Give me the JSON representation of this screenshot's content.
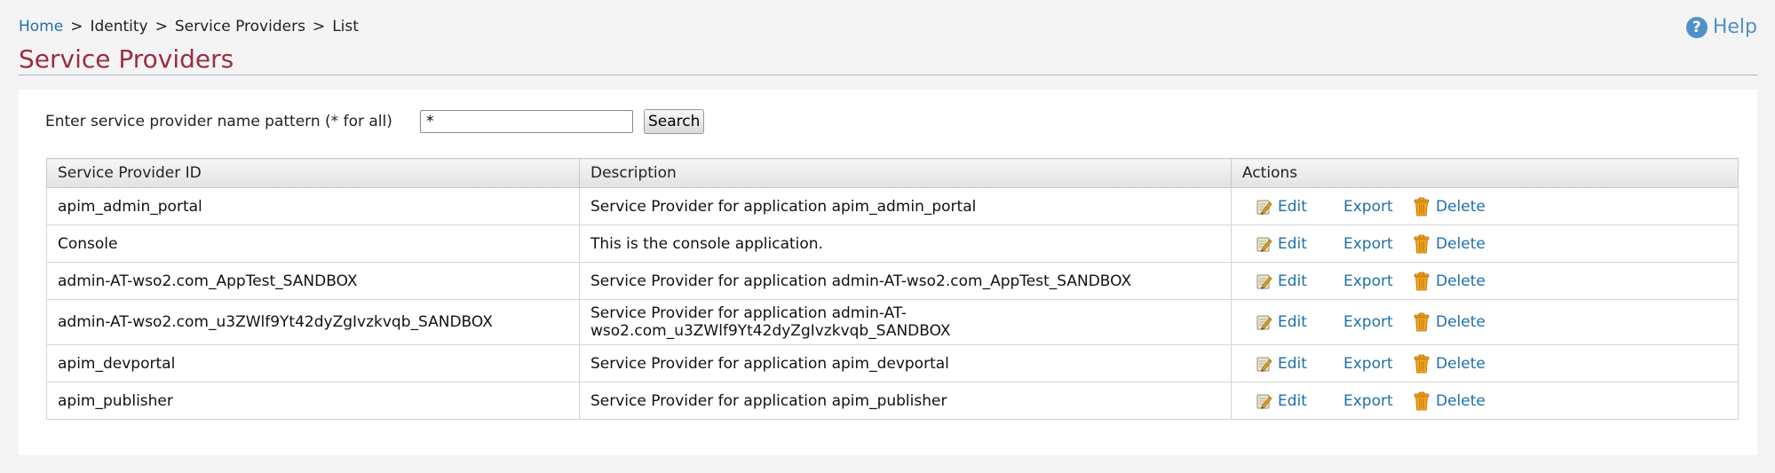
{
  "breadcrumb": {
    "home": "Home",
    "separator": ">",
    "identity": "Identity",
    "service_providers": "Service Providers",
    "current": "List"
  },
  "help": {
    "icon": "help-icon",
    "label": "Help",
    "color": "#4f90c8"
  },
  "page_title": "Service Providers",
  "title_color": "#9b2d3f",
  "link_color": "#1f6fa8",
  "search": {
    "label": "Enter service provider name pattern (* for all)",
    "value": "*",
    "button": "Search"
  },
  "table": {
    "headers": {
      "id": "Service Provider ID",
      "description": "Description",
      "actions": "Actions"
    },
    "action_labels": {
      "edit": "Edit",
      "export": "Export",
      "delete": "Delete"
    },
    "action_icons": {
      "edit": "edit-icon",
      "delete": "trash-icon"
    },
    "rows": [
      {
        "id": "apim_admin_portal",
        "description_line1": "Service Provider for application apim_admin_portal",
        "description_line2": ""
      },
      {
        "id": "Console",
        "description_line1": "This is the console application.",
        "description_line2": ""
      },
      {
        "id": "admin-AT-wso2.com_AppTest_SANDBOX",
        "description_line1": "Service Provider for application admin-AT-wso2.com_AppTest_SANDBOX",
        "description_line2": ""
      },
      {
        "id": "admin-AT-wso2.com_u3ZWlf9Yt42dyZgIvzkvqb_SANDBOX",
        "description_line1": "Service Provider for application admin-AT-",
        "description_line2": "wso2.com_u3ZWlf9Yt42dyZgIvzkvqb_SANDBOX"
      },
      {
        "id": "apim_devportal",
        "description_line1": "Service Provider for application apim_devportal",
        "description_line2": ""
      },
      {
        "id": "apim_publisher",
        "description_line1": "Service Provider for application apim_publisher",
        "description_line2": ""
      }
    ]
  }
}
